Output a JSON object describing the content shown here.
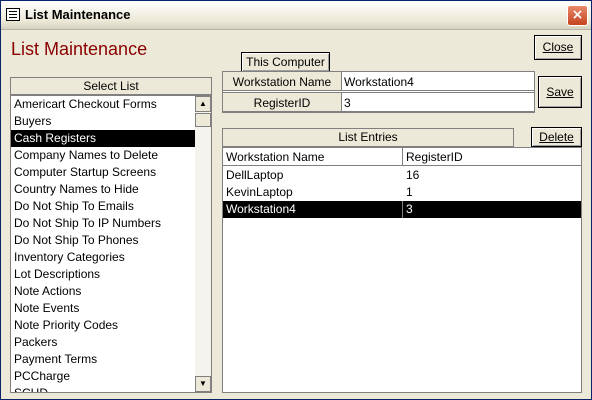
{
  "window": {
    "title": "List Maintenance",
    "close_glyph": "×"
  },
  "heading": "List Maintenance",
  "buttons": {
    "this_computer": "This Computer",
    "close": "Close",
    "save": "Save",
    "delete": "Delete"
  },
  "select_list": {
    "label": "Select List",
    "items": [
      "Americart Checkout Forms",
      "Buyers",
      "Cash Registers",
      "Company Names to Delete",
      "Computer Startup Screens",
      "Country Names to Hide",
      "Do Not Ship To Emails",
      "Do Not Ship To IP Numbers",
      "Do Not Ship To Phones",
      "Inventory Categories",
      "Lot Descriptions",
      "Note Actions",
      "Note Events",
      "Note Priority Codes",
      "Packers",
      "Payment Terms",
      "PCCharge",
      "SCHD"
    ],
    "selected_index": 2
  },
  "form": {
    "workstation_label": "Workstation Name",
    "workstation_value": "Workstation4",
    "register_label": "RegisterID",
    "register_value": "3"
  },
  "list_entries": {
    "label": "List Entries",
    "columns": [
      "Workstation Name",
      "RegisterID"
    ],
    "rows": [
      [
        "DellLaptop",
        "16"
      ],
      [
        "KevinLaptop",
        "1"
      ],
      [
        "Workstation4",
        "3"
      ]
    ],
    "selected_index": 2
  },
  "icons": {
    "window": "form-icon",
    "scroll_up": "arrow-up-icon",
    "scroll_down": "arrow-down-icon"
  }
}
